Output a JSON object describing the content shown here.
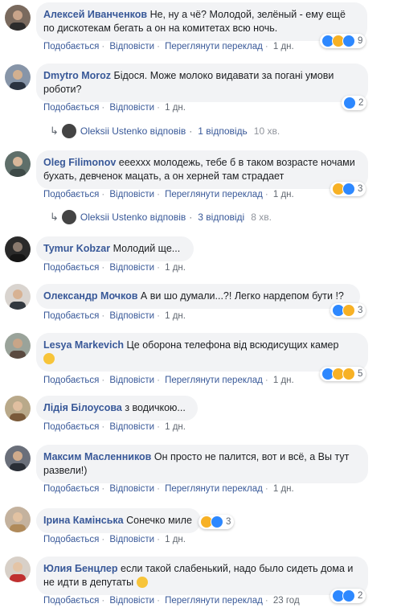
{
  "labels": {
    "like": "Подобається",
    "reply": "Відповісти",
    "translate": "Переглянути переклад",
    "replied": "відповів"
  },
  "comments": [
    {
      "author": "Алексей Иванченков",
      "text": "Не, ну а чё? Молодой, зелёный - ему ещё по дискотекам бегать а он на комитетах всю ночь.",
      "time": "1 дн.",
      "reacts": "9"
    },
    {
      "author": "Dmytro Moroz",
      "text": "Бідося. Може молоко видавати за погані умови роботи?",
      "time": "1 дн.",
      "reacts": "2"
    },
    {
      "author": "Oleg Filimonov",
      "text": "eeexxx молодежь, тебе б в таком возрасте ночами бухать, девченок мацать, а он херней там страдает",
      "time": "1 дн.",
      "reacts": "3"
    },
    {
      "author": "Tymur Kobzar",
      "text": "Молодий ще...",
      "time": "1 дн."
    },
    {
      "author": "Олександр Мочков",
      "text": "А ви шо думали...?! Легко нардепом бути !?",
      "time": "1 дн.",
      "reacts": "3"
    },
    {
      "author": "Lesya Markevich",
      "text": "Це оборона телефона від всюдисущих камер",
      "time": "1 дн.",
      "reacts": "5"
    },
    {
      "author": "Лідія Білоусова",
      "text": "з водичкою...",
      "time": "1 дн."
    },
    {
      "author": "Максим Масленников",
      "text": "Он просто не палится, вот и всё, а Вы тут развели!)",
      "time": "1 дн."
    },
    {
      "author": "Ірина Камінська",
      "text": "Сонечко миле",
      "time": "1 дн.",
      "reacts": "3"
    },
    {
      "author": "Юлия Бенцлер",
      "text": "если такой слабенький, надо было сидеть дома и не идти в депутаты",
      "time": "23 год",
      "reacts": "2"
    }
  ],
  "replies": [
    {
      "name": "Oleksii Ustenko",
      "count": "1 відповідь",
      "time": "10 хв."
    },
    {
      "name": "Oleksii Ustenko",
      "count": "3 відповіді",
      "time": "8 хв."
    }
  ],
  "colors": {
    "link": "#385898",
    "bubble": "#f2f3f5",
    "meta": "#606770",
    "like": "#2d88ff",
    "haha": "#f7b125"
  }
}
